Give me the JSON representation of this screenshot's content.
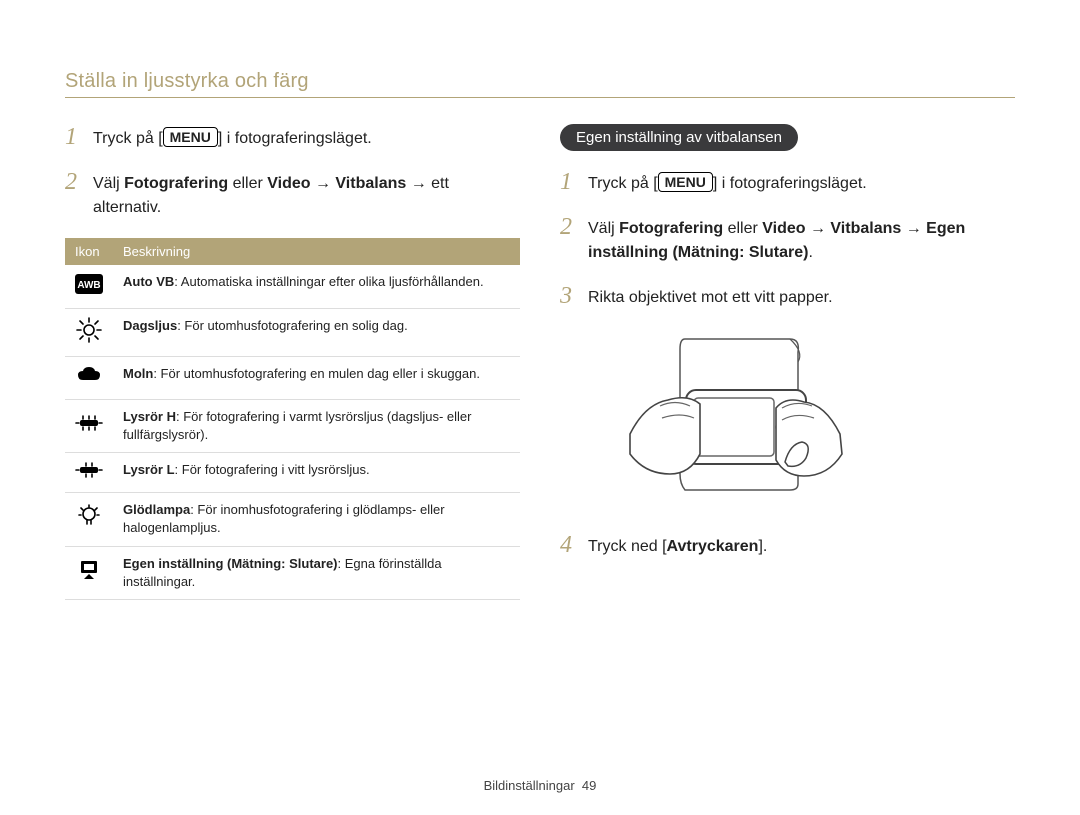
{
  "page": {
    "title": "Ställa in ljusstyrka och färg",
    "footer_label": "Bildinställningar",
    "footer_page": "49"
  },
  "left": {
    "step1": {
      "num": "1",
      "pre": "Tryck på [",
      "menu": "MENU",
      "post": "] i fotograferingsläget."
    },
    "step2": {
      "num": "2",
      "a": "Välj ",
      "b1": "Fotografering",
      "mid": " eller ",
      "b2": "Video",
      "arrow1": " → ",
      "b3": "Vitbalans",
      "tail": " → ett alternativ."
    },
    "table": {
      "head_icon": "Ikon",
      "head_desc": "Beskrivning",
      "rows": [
        {
          "icon": "awb",
          "title": "Auto VB",
          "desc": ": Automatiska inställningar efter olika ljusförhållanden."
        },
        {
          "icon": "sun",
          "title": "Dagsljus",
          "desc": ": För utomhusfotografering en solig dag."
        },
        {
          "icon": "cloud",
          "title": "Moln",
          "desc": ": För utomhusfotografering en mulen dag eller i skuggan."
        },
        {
          "icon": "flH",
          "title": "Lysrör H",
          "desc": ": För fotografering i varmt lysrörsljus (dagsljus- eller fullfärgslysrör)."
        },
        {
          "icon": "flL",
          "title": "Lysrör L",
          "desc": ": För fotografering i vitt lysrörsljus."
        },
        {
          "icon": "bulb",
          "title": "Glödlampa",
          "desc": ": För inomhusfotografering i glödlamps- eller halogenlampljus."
        },
        {
          "icon": "custom",
          "title": "Egen inställning (Mätning: Slutare)",
          "desc": ": Egna förinställda inställningar."
        }
      ]
    }
  },
  "right": {
    "pill": "Egen inställning av vitbalansen",
    "step1": {
      "num": "1",
      "pre": "Tryck på [",
      "menu": "MENU",
      "post": "] i fotograferingsläget."
    },
    "step2": {
      "num": "2",
      "a": "Välj ",
      "b1": "Fotografering",
      "mid": " eller ",
      "b2": "Video",
      "arrow1": " → ",
      "b3": "Vitbalans",
      "arrow2": " → ",
      "b4": "Egen inställning (Mätning: Slutare)",
      "tail": "."
    },
    "step3": {
      "num": "3",
      "text": "Rikta objektivet mot ett vitt papper."
    },
    "step4": {
      "num": "4",
      "pre": "Tryck ned [",
      "b": "Avtryckaren",
      "post": "]."
    }
  }
}
